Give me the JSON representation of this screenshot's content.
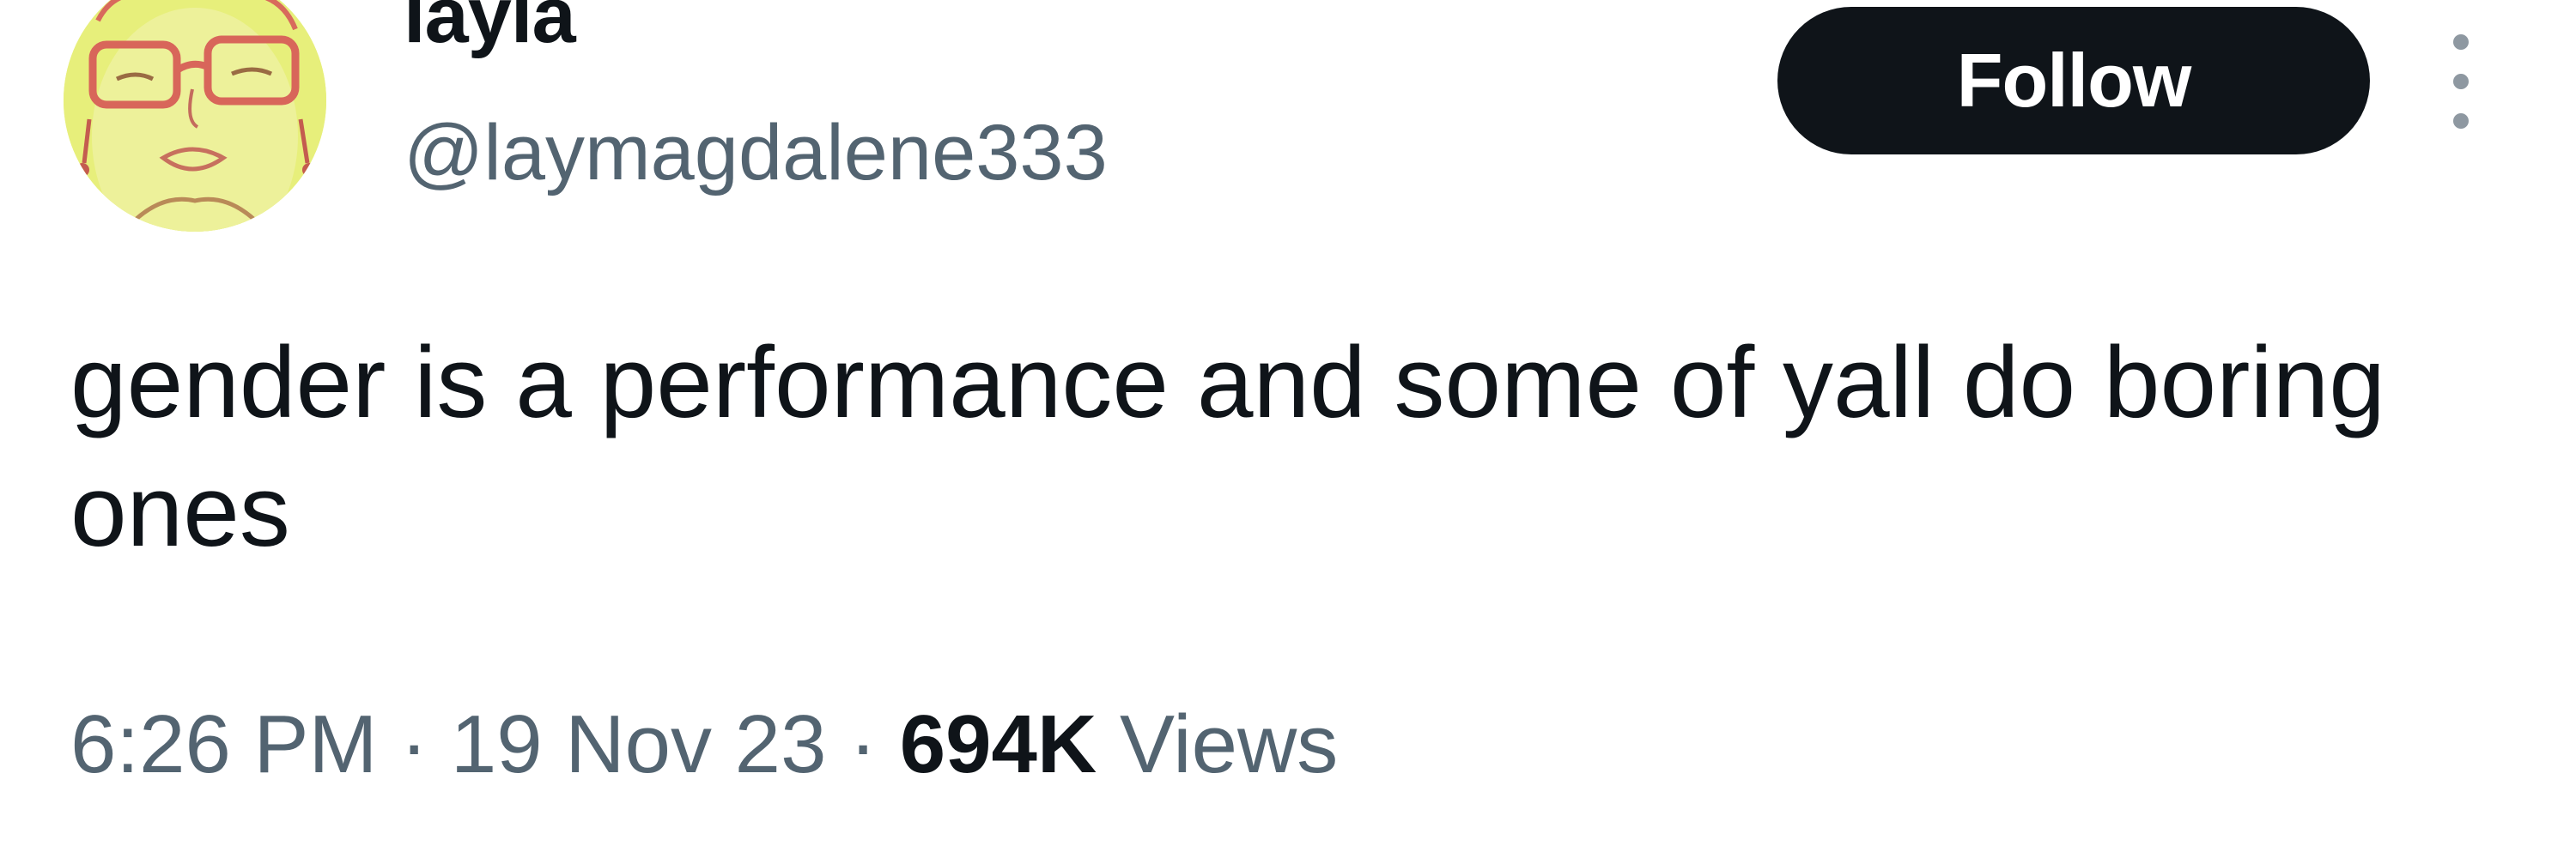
{
  "tweet": {
    "author": {
      "display_name": "layla",
      "handle": "@laymagdalene333",
      "avatar_icon": "cartoon-face-with-glasses-avatar"
    },
    "follow_label": "Follow",
    "more_icon": "vertical-ellipsis-icon",
    "text": "gender is a performance and some of yall do boring ones",
    "time": "6:26 PM",
    "separator": "·",
    "date": "19 Nov 23",
    "views_count": "694K",
    "views_label": "Views"
  },
  "colors": {
    "text_primary": "#0f1419",
    "text_secondary": "#536471",
    "follow_button_bg": "#0f1419",
    "avatar_bg": "#e7ef7b"
  }
}
